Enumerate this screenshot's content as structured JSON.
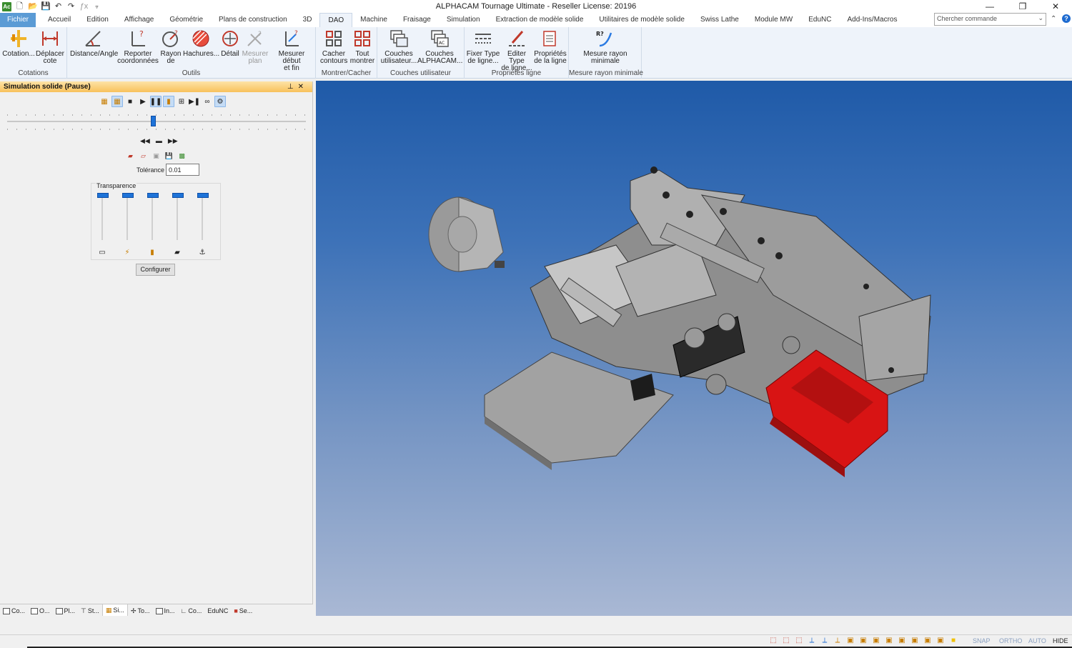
{
  "window": {
    "title": "ALPHACAM Tournage Ultimate - Reseller License: 20196",
    "logo": "Ac",
    "controls": {
      "minimize": "—",
      "restore": "❐",
      "close": "✕"
    }
  },
  "ribbon_tabs": [
    {
      "label": "Fichier"
    },
    {
      "label": "Accueil"
    },
    {
      "label": "Edition"
    },
    {
      "label": "Affichage"
    },
    {
      "label": "Géométrie"
    },
    {
      "label": "Plans de construction"
    },
    {
      "label": "3D"
    },
    {
      "label": "DAO"
    },
    {
      "label": "Machine"
    },
    {
      "label": "Fraisage"
    },
    {
      "label": "Simulation"
    },
    {
      "label": "Extraction de modèle solide"
    },
    {
      "label": "Utilitaires de modèle solide"
    },
    {
      "label": "Swiss Lathe"
    },
    {
      "label": "Module MW"
    },
    {
      "label": "EduNC"
    },
    {
      "label": "Add-Ins/Macros"
    }
  ],
  "search": {
    "placeholder": "Chercher commande",
    "help": "?"
  },
  "ribbon": {
    "groups": [
      {
        "name": "Cotations",
        "buttons": [
          {
            "l1": "Cotation...",
            "l2": ""
          },
          {
            "l1": "Déplacer",
            "l2": "cote"
          }
        ]
      },
      {
        "name": "Outils",
        "buttons": [
          {
            "l1": "Distance/Angle",
            "l2": ""
          },
          {
            "l1": "Reporter",
            "l2": "coordonnées"
          },
          {
            "l1": "Rayon",
            "l2": "de"
          },
          {
            "l1": "Hachures...",
            "l2": ""
          },
          {
            "l1": "Détail",
            "l2": ""
          },
          {
            "l1": "Mesurer",
            "l2": "plan"
          },
          {
            "l1": "Mesurer début",
            "l2": "et fin"
          }
        ]
      },
      {
        "name": "Montrer/Cacher",
        "buttons": [
          {
            "l1": "Cacher",
            "l2": "contours"
          },
          {
            "l1": "Tout",
            "l2": "montrer"
          }
        ]
      },
      {
        "name": "Couches utilisateur",
        "buttons": [
          {
            "l1": "Couches",
            "l2": "utilisateur..."
          },
          {
            "l1": "Couches",
            "l2": "ALPHACAM..."
          }
        ]
      },
      {
        "name": "Propriétés ligne",
        "buttons": [
          {
            "l1": "Fixer Type",
            "l2": "de ligne..."
          },
          {
            "l1": "Editer Type",
            "l2": "de ligne..."
          },
          {
            "l1": "Propriétés",
            "l2": "de la ligne"
          }
        ]
      },
      {
        "name": "Mesure rayon minimale",
        "buttons": [
          {
            "l1": "Mesure rayon",
            "l2": "minimale"
          }
        ]
      }
    ]
  },
  "panel": {
    "title": "Simulation solide (Pause)",
    "pin": "📌",
    "close": "✕",
    "tolerance_label": "Tolérance",
    "tolerance_value": "0.01",
    "transparency_label": "Transparence",
    "configure_label": "Configurer",
    "slider_position": 0.49
  },
  "bottom_tabs": [
    {
      "label": "Co..."
    },
    {
      "label": "O..."
    },
    {
      "label": "Pl..."
    },
    {
      "label": "St..."
    },
    {
      "label": "Si..."
    },
    {
      "label": "To..."
    },
    {
      "label": "In..."
    },
    {
      "label": "Co..."
    },
    {
      "label": "EduNC"
    },
    {
      "label": "Se..."
    }
  ],
  "status": {
    "toggles": [
      "SNAP",
      "ORTHO",
      "AUTO",
      "HIDE"
    ]
  },
  "colors": {
    "accent": "#5b9bd5",
    "viewport_top": "#1f5aa8",
    "viewport_bottom": "#a9b8d4",
    "slider": "#1e73d8",
    "panel_title": "#f8c15c",
    "model_red": "#d81414"
  }
}
